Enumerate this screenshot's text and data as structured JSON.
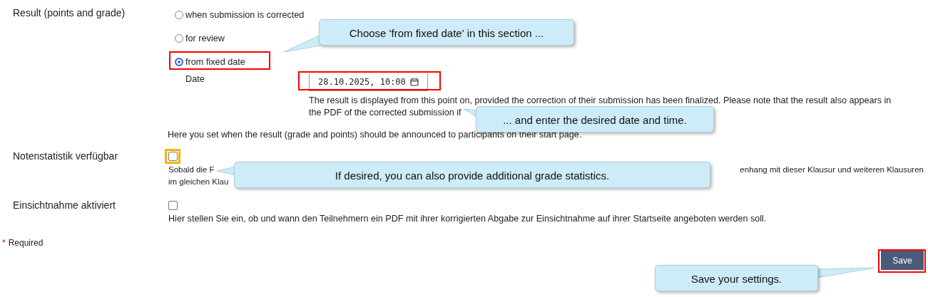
{
  "result_section": {
    "label": "Result (points and grade)",
    "options": [
      {
        "label": "when submission is corrected",
        "selected": false
      },
      {
        "label": "for review",
        "selected": false
      },
      {
        "label": "from fixed date",
        "selected": true
      }
    ],
    "date": {
      "label": "Date",
      "value": "28.10.2025, 10:00"
    },
    "date_help": [
      "The result is displayed from this point on, provided the correction of their submission has been finalized. Please note that the result also appears in",
      "the PDF of the corrected submission if"
    ],
    "help": "Here you set when the result (grade and points) should be announced to participants on their start page."
  },
  "grade_statistics": {
    "label": "Notenstatistik verfügbar",
    "checked": false,
    "help_fragments": [
      "Sobald die F",
      "enhang mit dieser Klausur und weiteren Klausuren",
      "im gleichen Klau"
    ]
  },
  "review": {
    "label": "Einsichtnahme aktiviert",
    "checked": false,
    "help": "Hier stellen Sie ein, ob und wann den Teilnehmern ein PDF mit ihrer korrigierten Abgabe zur Einsichtnahme auf ihrer Startseite angeboten werden soll."
  },
  "required_marker": "*",
  "required_label": "Required",
  "save_button": "Save",
  "callouts": [
    "Choose 'from fixed date' in this section ...",
    "... and enter the desired date and time.",
    "If desired, you can also provide additional grade statistics.",
    "Save your settings."
  ]
}
